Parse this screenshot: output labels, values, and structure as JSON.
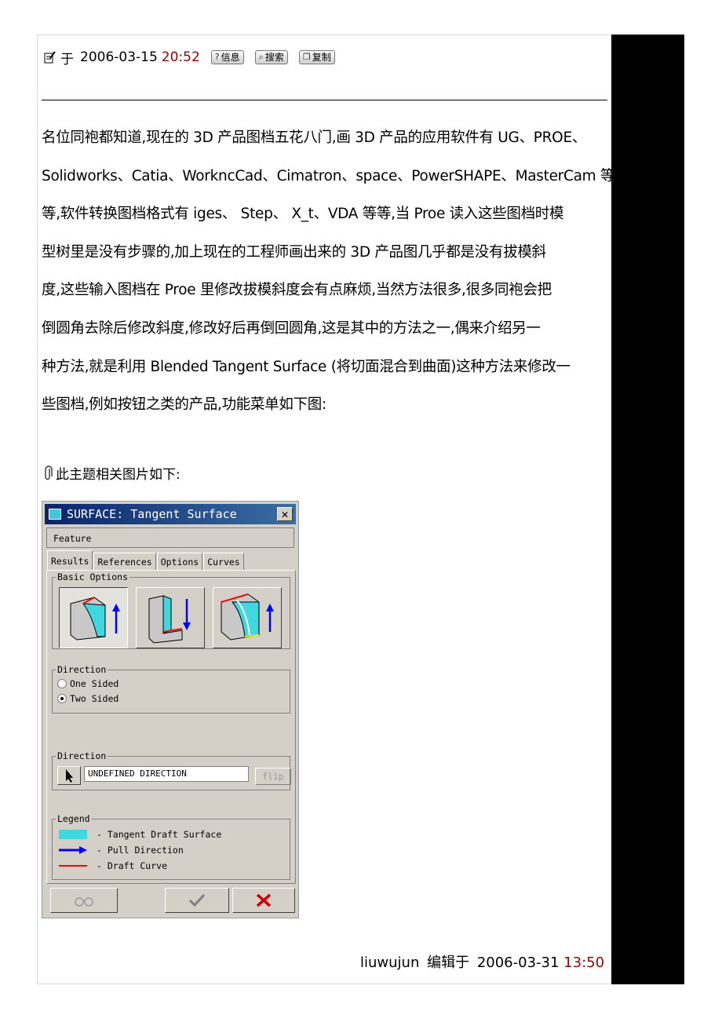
{
  "post": {
    "prefix": "于",
    "date": "2006-03-15",
    "time": "20:52",
    "buttons": [
      {
        "label": "信息",
        "icon": "info-icon"
      },
      {
        "label": "搜索",
        "icon": "search-icon"
      },
      {
        "label": "复制",
        "icon": "copy-icon"
      }
    ]
  },
  "body": {
    "lines": [
      "名位同袍都知道,现在的 3D 产品图档五花八门,画 3D 产品的应用软件有 UG、PROE、",
      "Solidworks、Catia、WorkncCad、Cimatron、space、PowerSHAPE、MasterCam 等",
      "等,软件转换图档格式有 iges、 Step、 X_t、VDA 等等,当 Proe 读入这些图档时模",
      "型树里是没有步骤的,加上现在的工程师画出来的 3D 产品图几乎都是没有拔模斜",
      "度,这些输入图档在 Proe 里修改拔模斜度会有点麻烦,当然方法很多,很多同袍会把",
      "倒圆角去除后修改斜度,修改好后再倒回圆角,这是其中的方法之一,偶来介绍另一",
      "种方法,就是利用 Blended Tangent Surface (将切面混合到曲面)这种方法来修改一",
      "些图档,例如按钮之类的产品,功能菜单如下图:"
    ]
  },
  "attachment": {
    "label": "此主题相关图片如下:"
  },
  "dialog": {
    "title": "SURFACE: Tangent Surface",
    "close": "✕",
    "feature": "Feature",
    "tabs": [
      "Results",
      "References",
      "Options",
      "Curves"
    ],
    "basic_options_label": "Basic Options",
    "direction_group_label": "Direction",
    "radio_one": "One Sided",
    "radio_two": "Two Sided",
    "direction2_label": "Direction",
    "direction_value": "UNDEFINED DIRECTION",
    "flip": "flip",
    "legend_label": "Legend",
    "legend": [
      {
        "text": "- Tangent Draft Surface",
        "color": "#40d8e0"
      },
      {
        "text": "- Pull Direction",
        "color": "#0000ff"
      },
      {
        "text": "- Draft Curve",
        "color": "#ff0000"
      }
    ]
  },
  "footer": {
    "author": "liuwujun",
    "edited": "编辑于",
    "date": "2006-03-31",
    "time": "13:50"
  }
}
